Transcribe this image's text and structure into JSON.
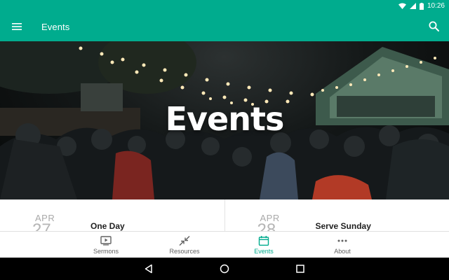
{
  "status_bar": {
    "time": "10:26"
  },
  "app_bar": {
    "title": "Events",
    "menu_icon": "hamburger-menu-icon",
    "search_icon": "search-icon"
  },
  "hero": {
    "title": "Events"
  },
  "events": [
    {
      "month": "APR",
      "day": "27",
      "title": "One Day"
    },
    {
      "month": "APR",
      "day": "28",
      "title": "Serve Sunday"
    }
  ],
  "bottom_nav": {
    "items": [
      {
        "label": "Sermons",
        "icon": "play-icon",
        "active": false
      },
      {
        "label": "Resources",
        "icon": "compress-icon",
        "active": false
      },
      {
        "label": "Events",
        "icon": "calendar-icon",
        "active": true
      },
      {
        "label": "About",
        "icon": "more-icon",
        "active": false
      }
    ]
  },
  "colors": {
    "primary": "#00ac8e",
    "text": "#212121",
    "muted": "#616161"
  }
}
